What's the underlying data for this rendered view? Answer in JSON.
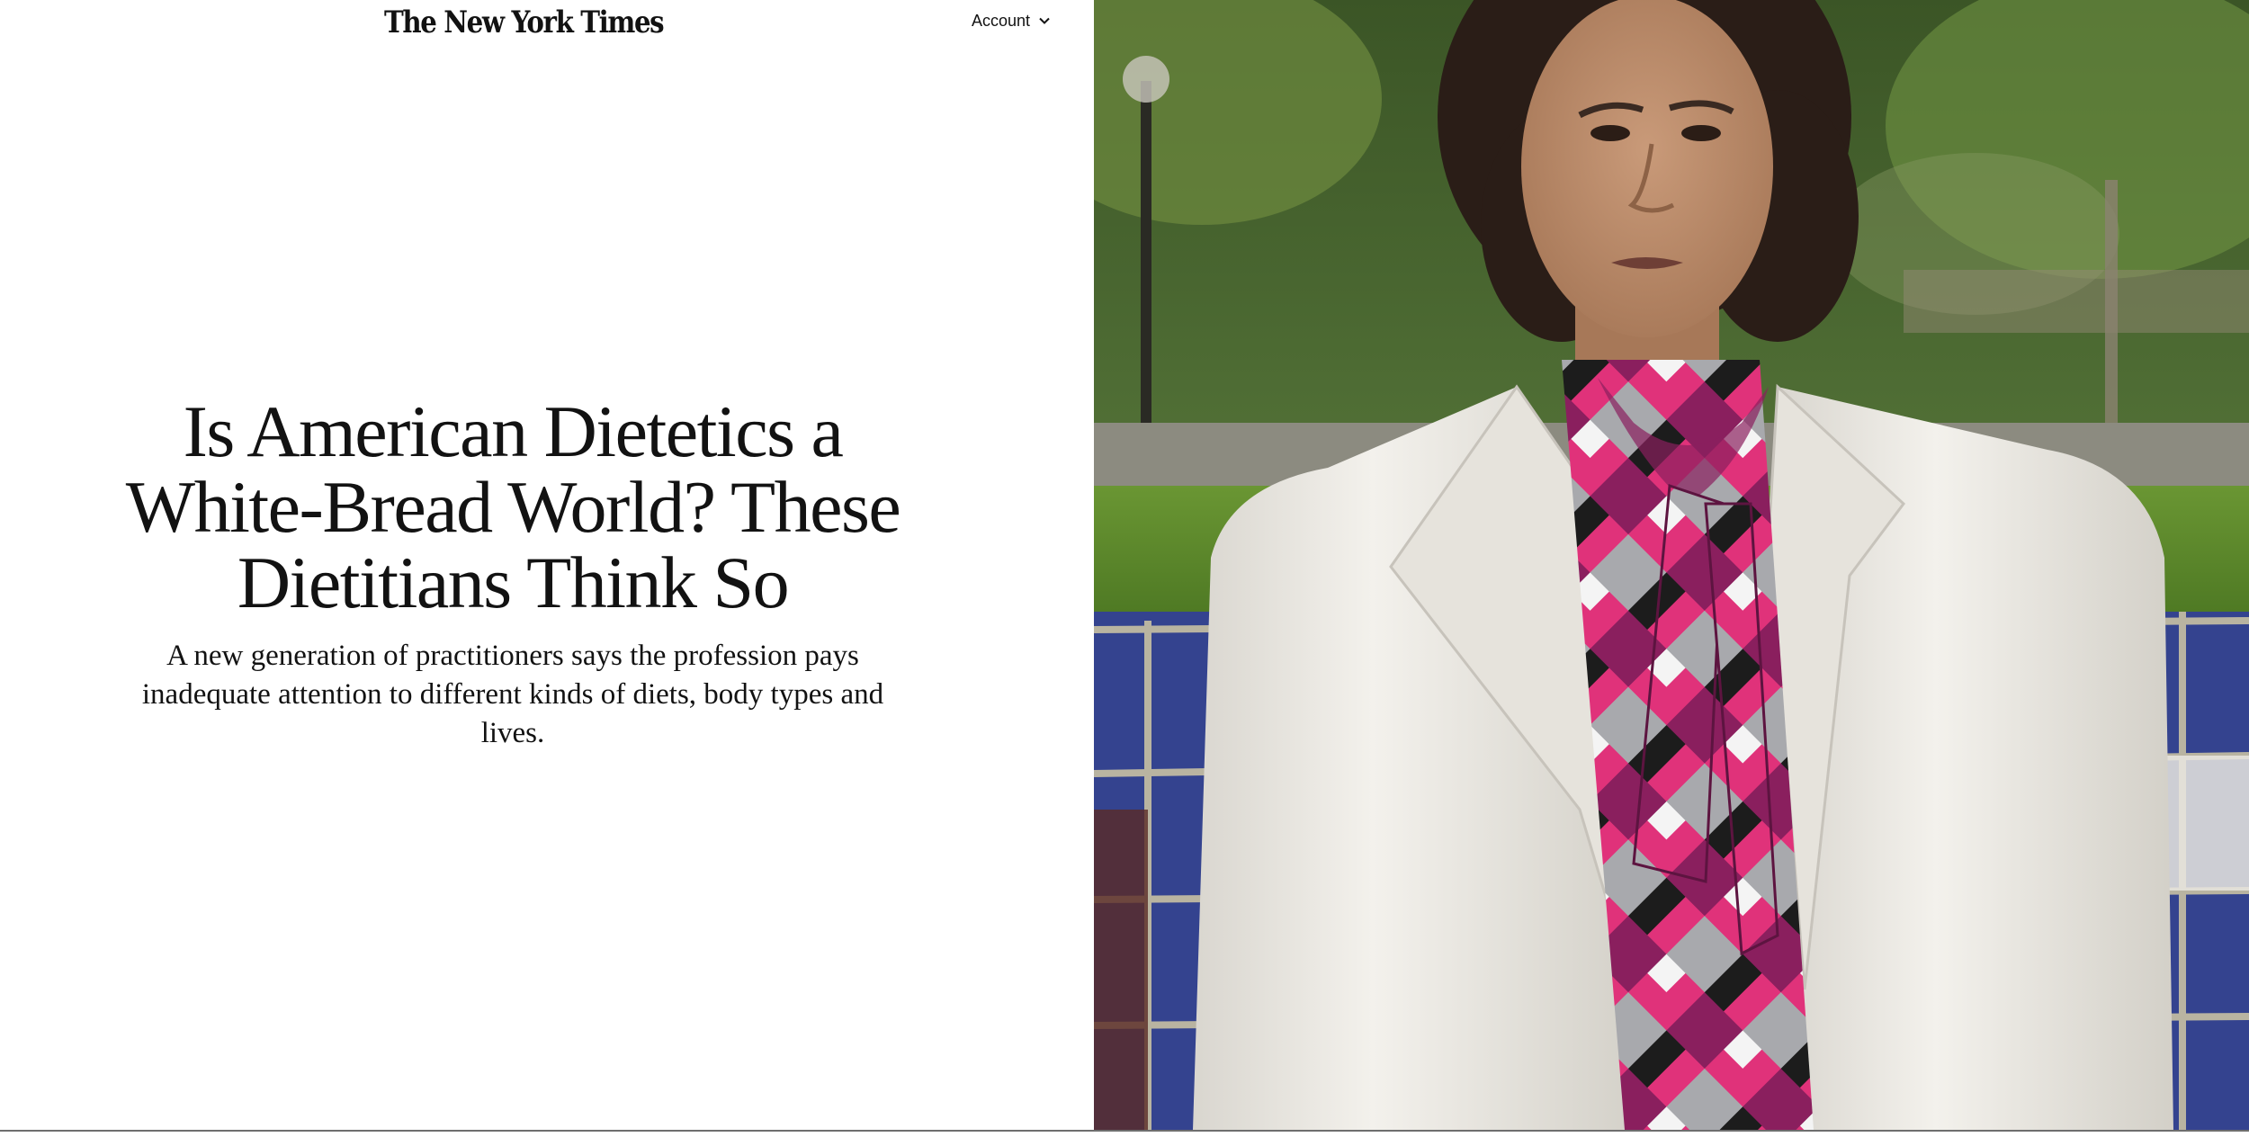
{
  "masthead": {
    "logo_text": "The New York Times",
    "account_label": "Account",
    "account_icon": "chevron-down-icon"
  },
  "article": {
    "headline_lines": [
      "Is American Dietetics a",
      "White-Bread World? These",
      "Dietitians Think So"
    ],
    "summary": "A new generation of practitioners says the profession pays inadequate attention to different kinds of diets, body types and lives."
  },
  "photo": {
    "subject": "portrait-photo",
    "colors": {
      "foliage": "#4c6b2e",
      "lawn": "#5f8a2a",
      "tile_blue": "#3c4fa8",
      "jacket": "#ece9e2",
      "scarf_pink": "#e0327a",
      "scarf_magenta": "#8a1f5e",
      "skin": "#b98a6a",
      "hair": "#2a1d17"
    }
  }
}
